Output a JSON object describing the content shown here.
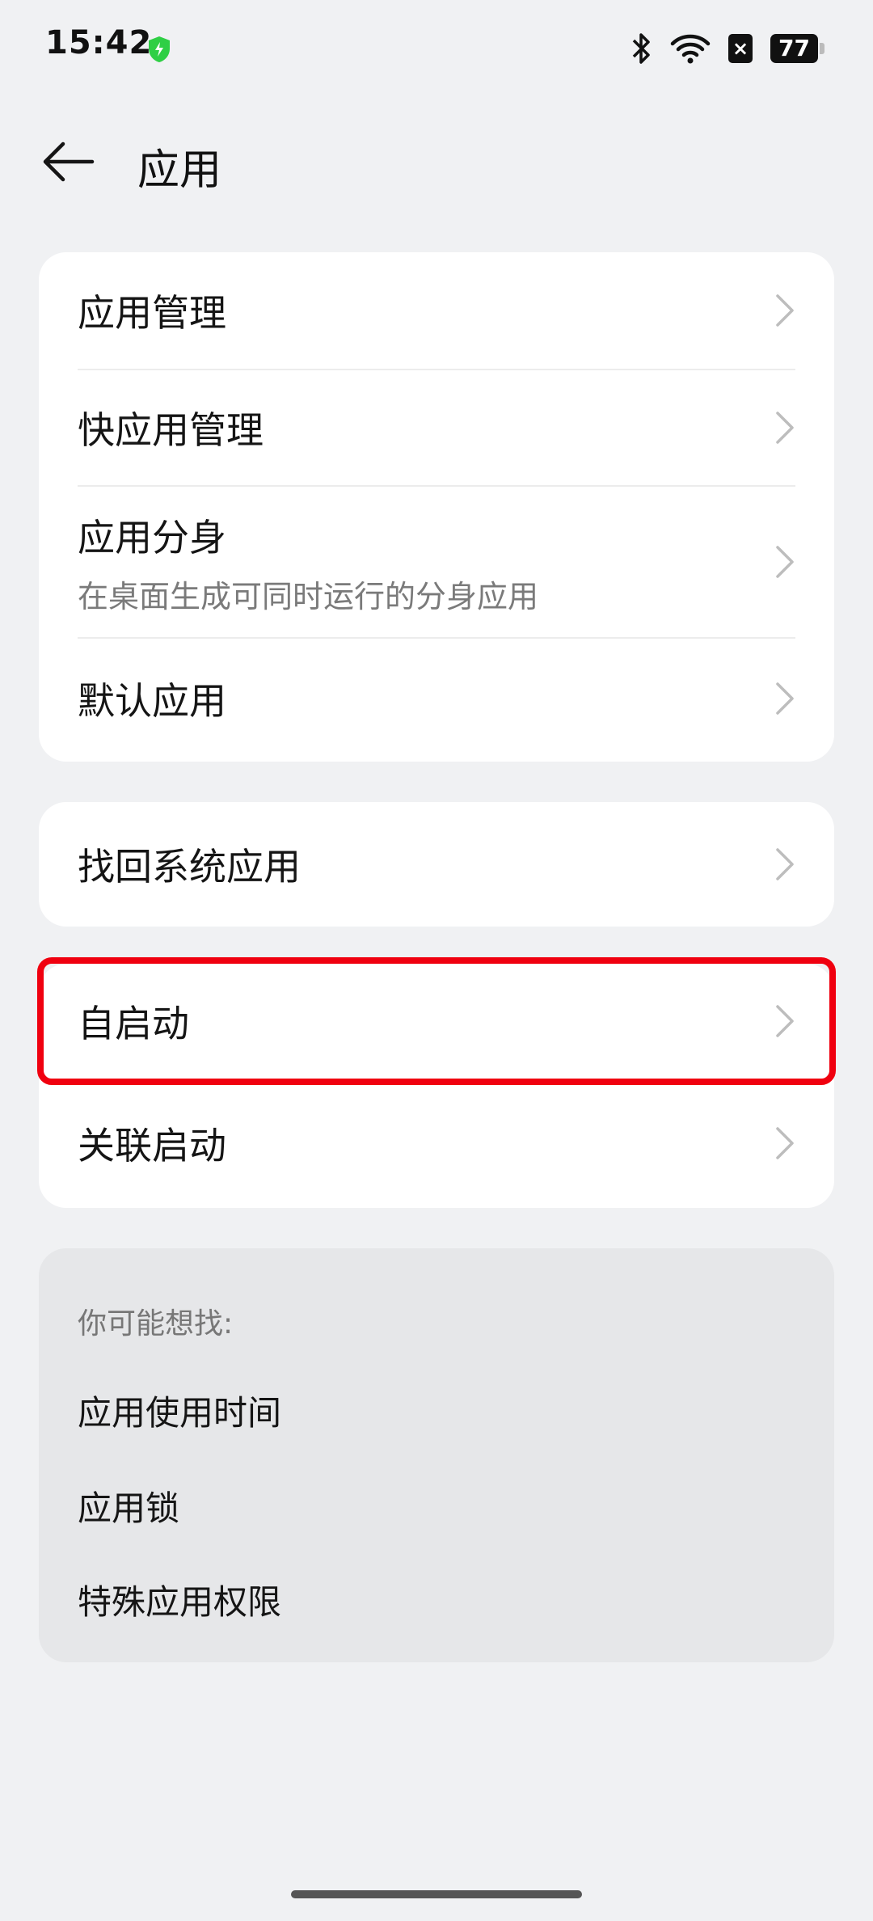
{
  "status_bar": {
    "time": "15:42",
    "battery": "77",
    "sim_indicator": "×",
    "icons": [
      "shield-check-icon",
      "bluetooth-icon",
      "wifi-icon",
      "sim-disabled-icon",
      "battery-icon"
    ],
    "shield_color": "#2fcf45"
  },
  "header": {
    "title": "应用"
  },
  "group1": {
    "items": [
      {
        "label": "应用管理"
      },
      {
        "label": "快应用管理"
      },
      {
        "label": "应用分身",
        "subtitle": "在桌面生成可同时运行的分身应用"
      },
      {
        "label": "默认应用"
      }
    ]
  },
  "group2": {
    "items": [
      {
        "label": "找回系统应用"
      }
    ]
  },
  "group3": {
    "items": [
      {
        "label": "自启动"
      },
      {
        "label": "关联启动"
      }
    ]
  },
  "suggestions": {
    "title": "你可能想找:",
    "links": [
      "应用使用时间",
      "应用锁",
      "特殊应用权限"
    ]
  },
  "colors": {
    "background": "#f0f1f3",
    "card": "#ffffff",
    "highlight_border": "#f0000f"
  }
}
